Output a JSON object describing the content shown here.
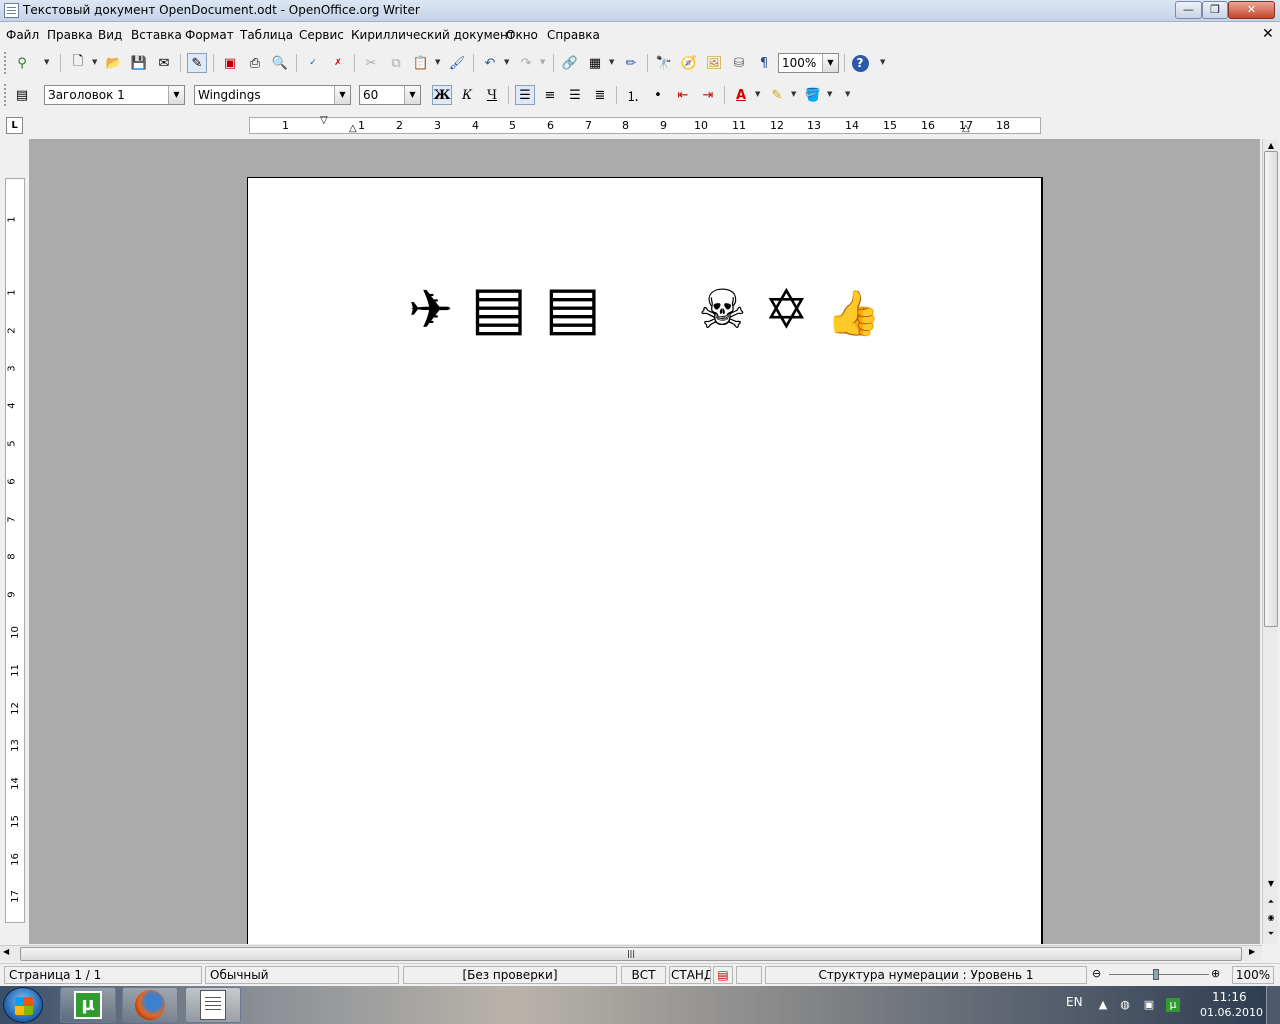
{
  "window": {
    "title": "Текстовый документ OpenDocument.odt - OpenOffice.org Writer",
    "minimize": "—",
    "maximize": "❐",
    "close": "✕"
  },
  "menu": {
    "items": [
      "Файл",
      "Правка",
      "Вид",
      "Вставка",
      "Формат",
      "Таблица",
      "Сервис",
      "Кириллический документ",
      "Окно",
      "Справка"
    ],
    "doc_close": "✕"
  },
  "toolbar_standard": {
    "zoom_value": "100%",
    "help_label": "?"
  },
  "toolbar_formatting": {
    "paragraph_style": "Заголовок 1",
    "font_name": "Wingdings",
    "font_size": "60",
    "bold_label": "Ж",
    "italic_label": "К",
    "underline_label": "Ч"
  },
  "ruler": {
    "tab_selector": "L",
    "h_numbers": [
      "1",
      "1",
      "2",
      "3",
      "4",
      "5",
      "6",
      "7",
      "8",
      "9",
      "10",
      "11",
      "12",
      "13",
      "14",
      "15",
      "16",
      "17",
      "18"
    ],
    "v_numbers": [
      "1",
      "1",
      "2",
      "3",
      "4",
      "5",
      "6",
      "7",
      "8",
      "9",
      "10",
      "11",
      "12",
      "13",
      "14",
      "15",
      "16",
      "17"
    ]
  },
  "document": {
    "glyphs": [
      "✈",
      "▤",
      "▤",
      "☠",
      "✡",
      "👍"
    ]
  },
  "statusbar": {
    "page": "Страница 1 / 1",
    "style": "Обычный",
    "language": "[Без проверки]",
    "insert_mode": "ВСТ",
    "selection_mode": "СТАНД",
    "outline": "Структура нумерации : Уровень 1",
    "zoom": "100%"
  },
  "taskbar": {
    "utorrent_label": "µ",
    "language": "EN",
    "time": "11:16",
    "date": "01.06.2010"
  }
}
